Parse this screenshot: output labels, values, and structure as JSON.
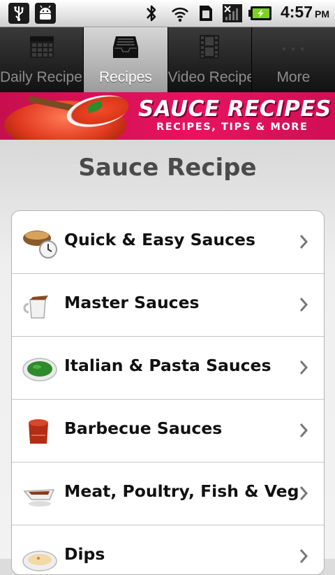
{
  "status_bar": {
    "icons": [
      "usb-icon",
      "android-debug-icon",
      "bluetooth-icon",
      "wifi-icon",
      "sim-card-icon",
      "no-signal-icon",
      "battery-charging-icon"
    ],
    "time": "4:57",
    "ampm": "PM"
  },
  "tabs": [
    {
      "label": "Daily Recipes",
      "icon": "calendar-icon",
      "active": false
    },
    {
      "label": "Recipes",
      "icon": "inbox-tray-icon",
      "active": true
    },
    {
      "label": "Video Recipe",
      "icon": "film-strip-icon",
      "active": false
    },
    {
      "label": "More",
      "icon": "more-dots-icon",
      "active": false
    }
  ],
  "banner": {
    "title": "SAUCE RECIPES",
    "subtitle": "RECIPES, TIPS & MORE"
  },
  "page": {
    "title": "Sauce Recipe"
  },
  "categories": [
    {
      "label": "Quick & Easy Sauces",
      "icon": "sauce-bowl-timer-icon"
    },
    {
      "label": "Master Sauces",
      "icon": "gravy-jug-icon"
    },
    {
      "label": "Italian & Pasta Sauces",
      "icon": "pesto-bowl-icon"
    },
    {
      "label": "Barbecue Sauces",
      "icon": "bbq-sauce-jar-icon"
    },
    {
      "label": "Meat, Poultry, Fish & Veg",
      "icon": "gravy-boat-icon"
    },
    {
      "label": "Dips",
      "icon": "dip-bowl-icon"
    }
  ],
  "colors": {
    "banner": "#e8135f",
    "tab_active": "#bdbdbd",
    "tab_bar": "#222222"
  }
}
